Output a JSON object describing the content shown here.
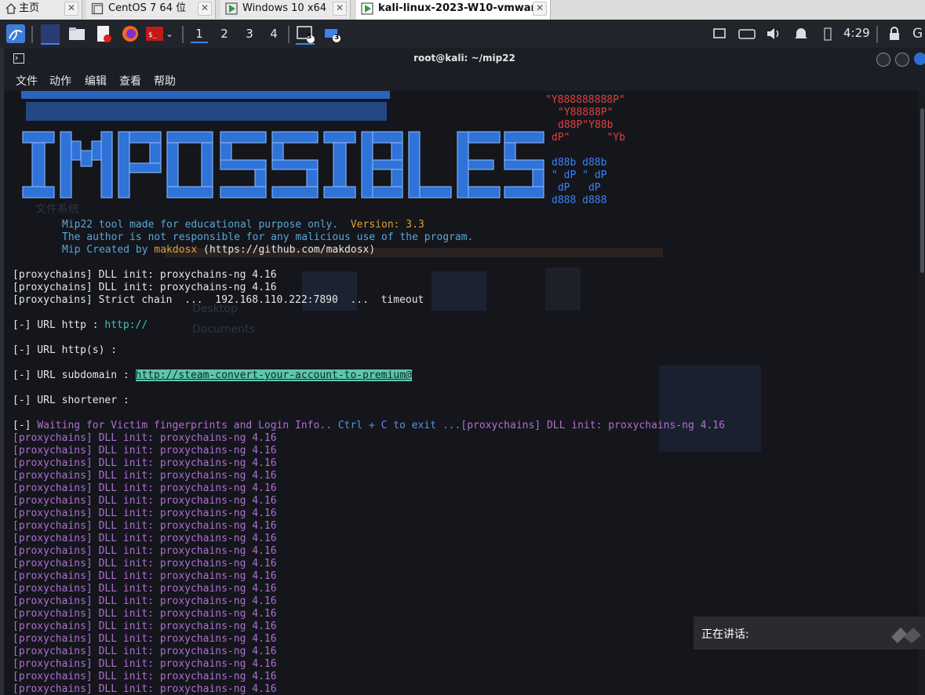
{
  "tabs": [
    {
      "label": "主页",
      "icon": "home-icon"
    },
    {
      "label": "CentOS 7 64 位",
      "icon": "vm-icon"
    },
    {
      "label": "Windows 10 x64",
      "icon": "vm-running-icon"
    },
    {
      "label": "kali-linux-2023-W10-vmwar...",
      "icon": "vm-running-icon",
      "active": true
    }
  ],
  "panel": {
    "workspaces": [
      "1",
      "2",
      "3",
      "4"
    ],
    "badge_terminal": "3",
    "badge_files": "3",
    "clock": "4:29"
  },
  "window": {
    "title": "root@kali: ~/mip22",
    "menu": [
      "文件",
      "动作",
      "编辑",
      "查看",
      "帮助"
    ]
  },
  "banner": {
    "word": "IMPOSSIBLES",
    "right_art_red": [
      "\"Y888888888P\"",
      "\"Y88888P\"",
      "d88P\"Y88b",
      "dP\"      \"Yb"
    ],
    "right_art_blue": [
      "d88b d88b",
      "\" dP \" dP",
      " dP   dP",
      "d888 d888"
    ]
  },
  "info": {
    "line1": "Mip22 tool made for educational purpose only.",
    "version_label": "Version: 3.3",
    "line2": "The author is not responsible for any malicious use of the program.",
    "line3_prefix": "Mip Created by ",
    "author": "makdosx",
    "line3_suffix": " (https://github.com/makdosx)"
  },
  "output": {
    "init1": "[proxychains] DLL init: proxychains-ng 4.16",
    "init2": "[proxychains] DLL init: proxychains-ng 4.16",
    "strict": "[proxychains] Strict chain  ...  192.168.110.222:7890  ...  timeout",
    "url_http_label": "[-] URL http : ",
    "url_http_value": "http://",
    "url_https_label": "[-] URL http(s) :",
    "url_sub_label": "[-] URL subdomain : ",
    "url_sub_value": "http://steam-convert-your-account-to-premium@",
    "url_short_label": "[-] URL shortener :",
    "waiting_prefix": "[-] ",
    "waiting_text": "Waiting for Victim fingerprints and Login Info..",
    "waiting_ctrl": " Ctrl + C to exit ...",
    "waiting_tail": "[proxychains] DLL init: proxychains-ng 4.16",
    "repeat_line": "[proxychains] DLL init: proxychains-ng 4.16",
    "repeat_count": 21
  },
  "speaking": {
    "label": "正在讲话:"
  }
}
